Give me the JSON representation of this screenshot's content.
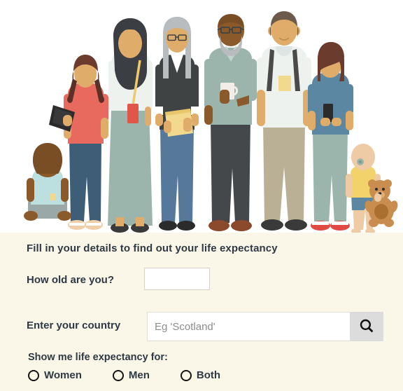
{
  "illustration": {
    "alt_name": "group-of-people-illustration",
    "figures": [
      {
        "name": "sitting-baby",
        "description": "Baby sitting facing away, light blue top, grey trousers"
      },
      {
        "name": "girl-with-tablet",
        "description": "Girl with pigtails in coral t-shirt holding a tablet"
      },
      {
        "name": "woman-in-hijab",
        "description": "Woman in dark hijab, white top, sage skirt, red shoulder bag"
      },
      {
        "name": "woman-with-book",
        "description": "Grey haired woman with glasses in dark cardigan holding yellow book"
      },
      {
        "name": "man-with-mug",
        "description": "Bald bearded man with glasses in sage polo holding a white mug"
      },
      {
        "name": "man-with-backpack",
        "description": "Tall man in white tee with yellow pocket wearing a backpack"
      },
      {
        "name": "teen-with-phone",
        "description": "Teenager with brown bob in blue t-shirt looking at a phone"
      },
      {
        "name": "toddler-with-teddy",
        "description": "Toddler with dummy in yellow top and blue shorts holding a teddy bear"
      }
    ],
    "colors": {
      "skin_light": "#EFCBA5",
      "skin_mid": "#E0AC69",
      "skin_dark": "#8B5A2B",
      "coral": "#E8695E",
      "sage": "#9BB5AC",
      "steel_blue": "#5B87A3",
      "denim": "#3E5E78",
      "charcoal": "#3F4344",
      "yellow": "#F2D98D",
      "khaki": "#B9B096",
      "offwhite": "#EDF2EF",
      "brown": "#8C5A32",
      "red_shoe": "#E04A43"
    }
  },
  "form": {
    "intro": "Fill in your details to find out your life expectancy",
    "age": {
      "label": "How old are you?",
      "value": "",
      "placeholder": ""
    },
    "country": {
      "label": "Enter your country",
      "value": "",
      "placeholder": "Eg 'Scotland'",
      "search_icon": "search-icon"
    },
    "gender": {
      "heading": "Show me life expectancy for:",
      "options": [
        {
          "label": "Women",
          "selected": false
        },
        {
          "label": "Men",
          "selected": false
        },
        {
          "label": "Both",
          "selected": false
        }
      ]
    }
  },
  "colors": {
    "panel_bg": "#FAF7E8",
    "text": "#2E3944",
    "placeholder": "#8C8C8C",
    "search_btn_bg": "#DCDCDC",
    "input_border": "#E2DED2"
  }
}
